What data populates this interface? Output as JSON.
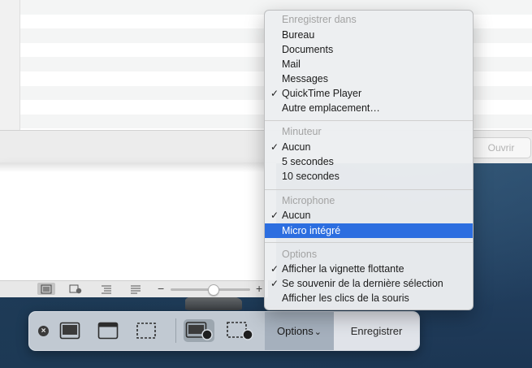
{
  "window": {
    "open_button": "Ouvrir"
  },
  "toolbar": {
    "close_icon": "close-icon",
    "options_label": "Options",
    "options_chevron": "⌄",
    "record_label": "Enregistrer"
  },
  "menu": {
    "sections": [
      {
        "header": "Enregistrer dans",
        "items": [
          {
            "label": "Bureau",
            "checked": false
          },
          {
            "label": "Documents",
            "checked": false
          },
          {
            "label": "Mail",
            "checked": false
          },
          {
            "label": "Messages",
            "checked": false
          },
          {
            "label": "QuickTime Player",
            "checked": true
          },
          {
            "label": "Autre emplacement…",
            "checked": false
          }
        ]
      },
      {
        "header": "Minuteur",
        "items": [
          {
            "label": "Aucun",
            "checked": true
          },
          {
            "label": "5 secondes",
            "checked": false
          },
          {
            "label": "10 secondes",
            "checked": false
          }
        ]
      },
      {
        "header": "Microphone",
        "items": [
          {
            "label": "Aucun",
            "checked": true
          },
          {
            "label": "Micro intégré",
            "checked": false,
            "highlighted": true
          }
        ]
      },
      {
        "header": "Options",
        "items": [
          {
            "label": "Afficher la vignette flottante",
            "checked": true
          },
          {
            "label": "Se souvenir de la dernière sélection",
            "checked": true
          },
          {
            "label": "Afficher les clics de la souris",
            "checked": false
          }
        ]
      }
    ],
    "check_glyph": "✓"
  },
  "statusbar": {
    "zoom_minus": "−",
    "zoom_plus": "+",
    "zoom_level": 0.5
  },
  "colors": {
    "highlight": "#2c6ee0",
    "menu_bg": "#eceef1"
  }
}
